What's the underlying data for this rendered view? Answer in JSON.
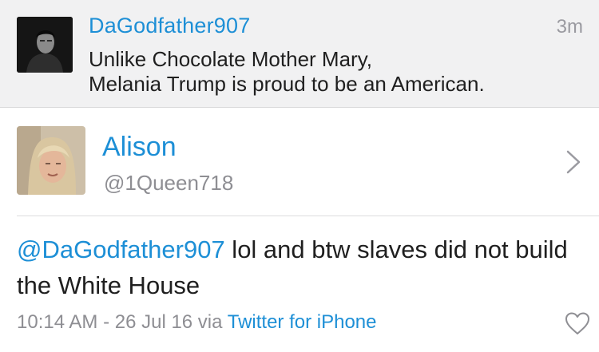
{
  "context_tweet": {
    "author_name": "DaGodfather907",
    "time": "3m",
    "text_line1": "Unlike Chocolate Mother Mary,",
    "text_line2": "Melania Trump is proud to be an American."
  },
  "tweet": {
    "author_name": "Alison",
    "author_handle": "@1Queen718",
    "mention": "@DaGodfather907",
    "text_after_mention": " lol and btw slaves did not build the White House",
    "time": "10:14 AM",
    "separator": " - ",
    "date": "26 Jul 16",
    "via_label": " via ",
    "client": "Twitter for iPhone"
  },
  "icons": {
    "profile_chevron": "chevron-right-icon",
    "like": "heart-icon"
  },
  "colors": {
    "link_blue": "#1d8fd6",
    "context_background": "#f1f1f2",
    "secondary_text": "#8e8e93"
  }
}
